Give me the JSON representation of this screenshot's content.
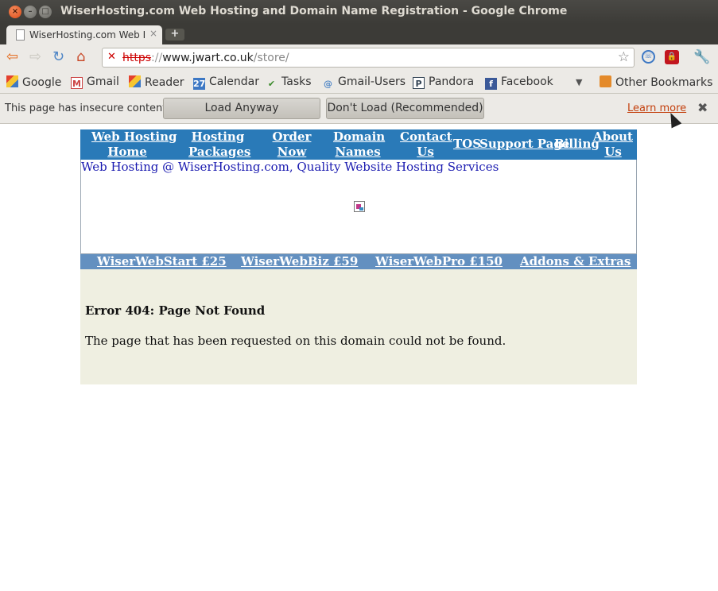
{
  "window": {
    "title": "WiserHosting.com Web Hosting and Domain Name Registration - Google Chrome",
    "close_glyph": "×",
    "min_glyph": "–",
    "max_glyph": "□"
  },
  "tab": {
    "title": "WiserHosting.com Web Ho",
    "close_glyph": "×",
    "new_tab_glyph": "+"
  },
  "toolbar": {
    "back_glyph": "⇦",
    "forward_glyph": "⇨",
    "reload_glyph": "↻",
    "home_glyph": "⌂",
    "url": {
      "scheme": "https",
      "sep": "://",
      "host": "www.jwart.co.uk",
      "path": "/store/"
    },
    "star_glyph": "☆",
    "wrench_glyph": "🔧"
  },
  "bookmarks": {
    "items": [
      {
        "label": "Google",
        "icon": "google-icon",
        "glyph": ""
      },
      {
        "label": "Gmail",
        "icon": "gmail-icon",
        "glyph": "M"
      },
      {
        "label": "Reader",
        "icon": "reader-icon",
        "glyph": ""
      },
      {
        "label": "Calendar",
        "icon": "calendar-icon",
        "glyph": "27"
      },
      {
        "label": "Tasks",
        "icon": "tasks-icon",
        "glyph": "✔"
      },
      {
        "label": "Gmail-Users",
        "icon": "gmail-users-icon",
        "glyph": "@"
      },
      {
        "label": "Pandora",
        "icon": "pandora-icon",
        "glyph": "P"
      },
      {
        "label": "Facebook",
        "icon": "facebook-icon",
        "glyph": "f"
      }
    ],
    "more_glyph": "▼",
    "other": "Other Bookmarks"
  },
  "infobar": {
    "message": "This page has insecure content.",
    "load_anyway": "Load Anyway",
    "dont_load": "Don't Load (Recommended)",
    "learn_more": "Learn more",
    "close_glyph": "✖"
  },
  "site": {
    "topnav": [
      {
        "line1": "Web Hosting",
        "line2": "Home"
      },
      {
        "line1": "Hosting",
        "line2": "Packages"
      },
      {
        "line1": "Order",
        "line2": "Now"
      },
      {
        "line1": "Domain",
        "line2": "Names"
      },
      {
        "line1": "Contact",
        "line2": "Us"
      },
      {
        "line1": "TOS",
        "line2": ""
      },
      {
        "line1": "Support Page",
        "line2": ""
      },
      {
        "line1": "Billing",
        "line2": ""
      },
      {
        "line1": "About",
        "line2": "Us"
      }
    ],
    "banner_text": "Web Hosting @ WiserHosting.com, Quality Website Hosting Services",
    "plans": [
      "WiserWebStart £25",
      "WiserWebBiz £59",
      "WiserWebPro £150",
      "Addons & Extras"
    ],
    "error_title": "Error 404: Page Not Found",
    "error_body": "The page that has been requested on this domain could not be found."
  },
  "colors": {
    "nav_bg": "#2a7ab8",
    "plans_bg": "#6390c0",
    "content_bg": "#efefe1",
    "banner_link": "#1a1ab0"
  }
}
